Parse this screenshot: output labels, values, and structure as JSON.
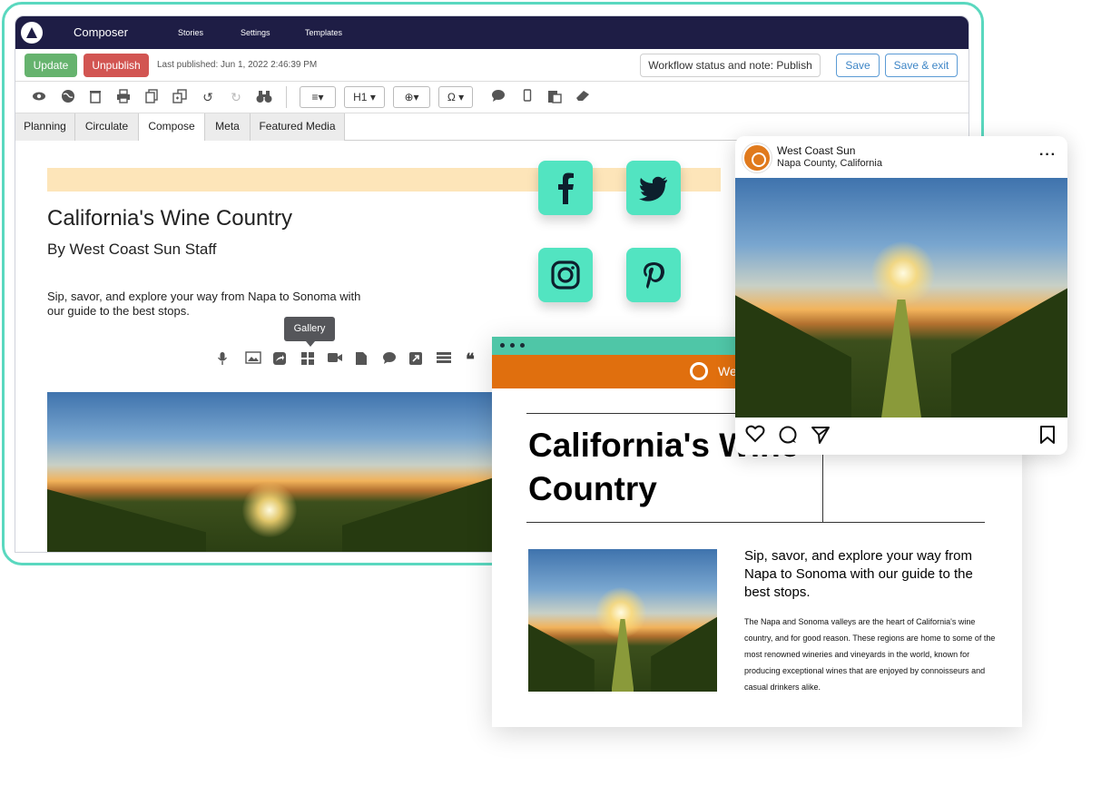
{
  "app": {
    "name": "Composer",
    "nav": [
      "Stories",
      "Settings",
      "Templates"
    ]
  },
  "actionbar": {
    "update": "Update",
    "unpublish": "Unpublish",
    "last_published": "Last published: Jun 1, 2022 2:46:39 PM",
    "workflow": "Workflow status and note: Publish",
    "save": "Save",
    "save_exit": "Save & exit"
  },
  "toolbar": {
    "align": "≡▾",
    "heading": "H1 ▾",
    "link": "⊕▾",
    "special": "Ω ▾"
  },
  "tabs": [
    "Planning",
    "Circulate",
    "Compose",
    "Meta",
    "Featured Media"
  ],
  "active_tab": "Compose",
  "editor": {
    "title": "California's Wine Country",
    "byline": "By West Coast Sun Staff",
    "dek": "Sip, savor, and explore your way from Napa to Sonoma with our guide to the best stops.",
    "tooltip": "Gallery"
  },
  "social": [
    "facebook",
    "twitter",
    "instagram",
    "pinterest"
  ],
  "instagram": {
    "account": "West Coast Sun",
    "location": "Napa County, California"
  },
  "newsletter": {
    "brand": "We",
    "title": "California's Wine Country",
    "dek": "Sip, savor, and explore your way from Napa to Sonoma with our guide to the best stops.",
    "body": "The Napa and Sonoma valleys are the heart of California's wine country, and for good reason. These regions are home to some of the most renowned wineries and vineyards in the world, known for producing exceptional wines that are enjoyed by connoisseurs and casual drinkers alike."
  },
  "colors": {
    "accent": "#5ad8bf",
    "topbar": "#1e1d45",
    "update": "#66b36e",
    "unpublish": "#d25552",
    "social_tile": "#52e4c1",
    "brand_orange": "#e06f0e"
  }
}
